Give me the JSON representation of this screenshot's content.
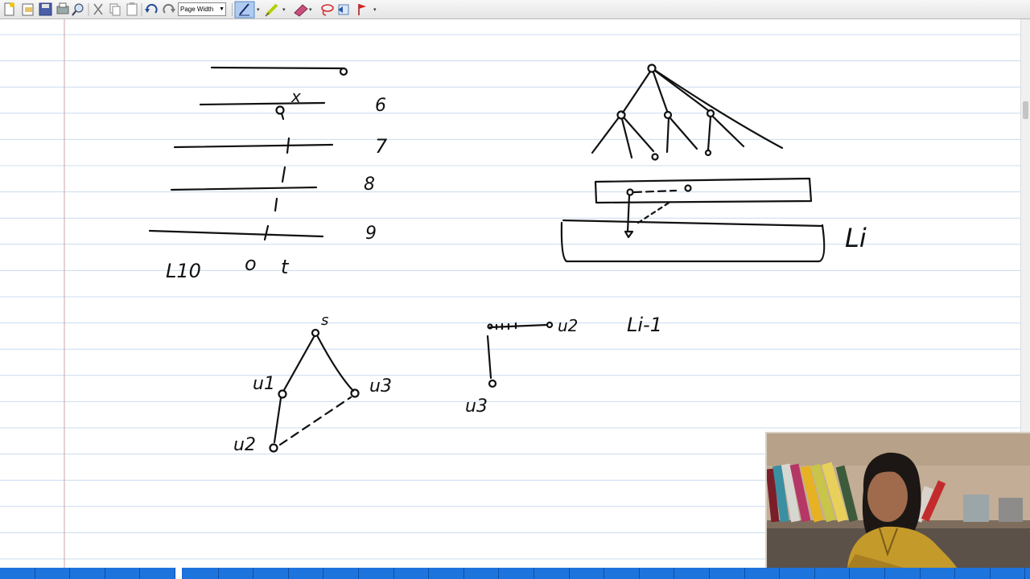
{
  "app": {
    "toolbar": {
      "zoom_label": "Page Width",
      "buttons": [
        "new-page-icon",
        "open-icon",
        "save-icon",
        "print-icon",
        "find-icon",
        "cut-icon",
        "copy-icon",
        "paste-icon",
        "undo-icon",
        "redo-icon",
        "pen-icon",
        "highlighter-icon",
        "eraser-icon",
        "lasso-icon",
        "insert-space-icon",
        "flag-icon"
      ],
      "active_tool": "pen-icon"
    },
    "page_indicator": "5"
  },
  "notes": {
    "levels": [
      "6",
      "7",
      "8",
      "9"
    ],
    "level_node_label": "x",
    "bottom_level_label": "L10",
    "bottom_labels": [
      "o",
      "t"
    ],
    "Li_label": "Li",
    "Li1_label": "Li-1",
    "triangle": {
      "s": "s",
      "u1": "u1",
      "u2": "u2",
      "u3": "u3"
    },
    "path": {
      "u2": "u2",
      "u3": "u3"
    }
  },
  "colors": {
    "ink": "#111111",
    "rule": "#c8dcef",
    "margin": "#c9a4a4",
    "pagebar": "#1b6fd6"
  }
}
